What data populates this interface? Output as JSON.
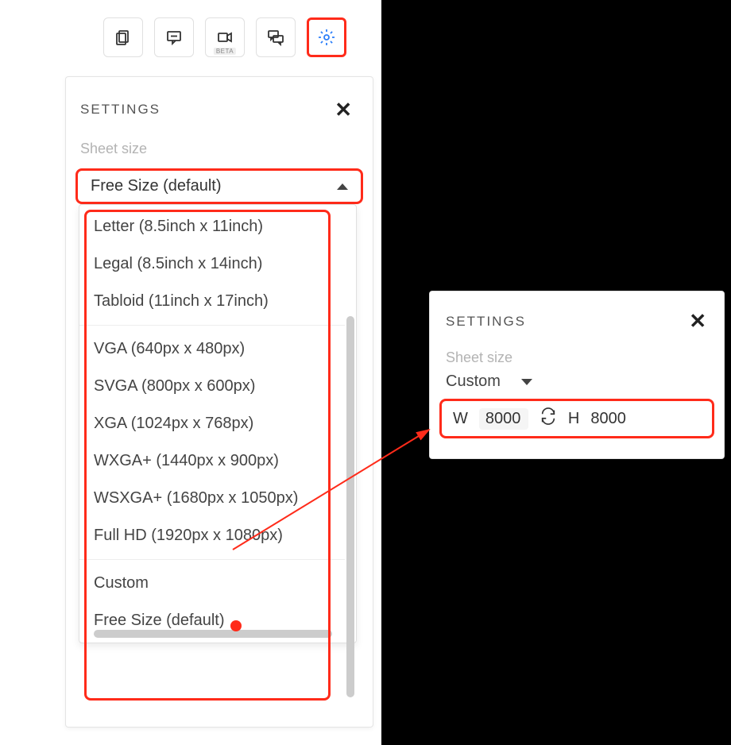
{
  "toolbar": {
    "beta_label": "BETA"
  },
  "panel": {
    "title": "SETTINGS",
    "sheet_size_label": "Sheet size",
    "selected": "Free Size (default)",
    "options_group1": [
      "Letter (8.5inch x 11inch)",
      "Legal (8.5inch x 14inch)",
      "Tabloid (11inch x 17inch)"
    ],
    "options_group2": [
      "VGA (640px x 480px)",
      "SVGA (800px x 600px)",
      "XGA (1024px x 768px)",
      "WXGA+ (1440px x 900px)",
      "WSXGA+ (1680px x 1050px)",
      "Full HD (1920px x 1080px)"
    ],
    "options_group3": [
      "Custom",
      "Free Size (default)"
    ]
  },
  "right": {
    "title": "SETTINGS",
    "sheet_size_label": "Sheet size",
    "selected": "Custom",
    "w_label": "W",
    "w_value": "8000",
    "h_label": "H",
    "h_value": "8000"
  }
}
